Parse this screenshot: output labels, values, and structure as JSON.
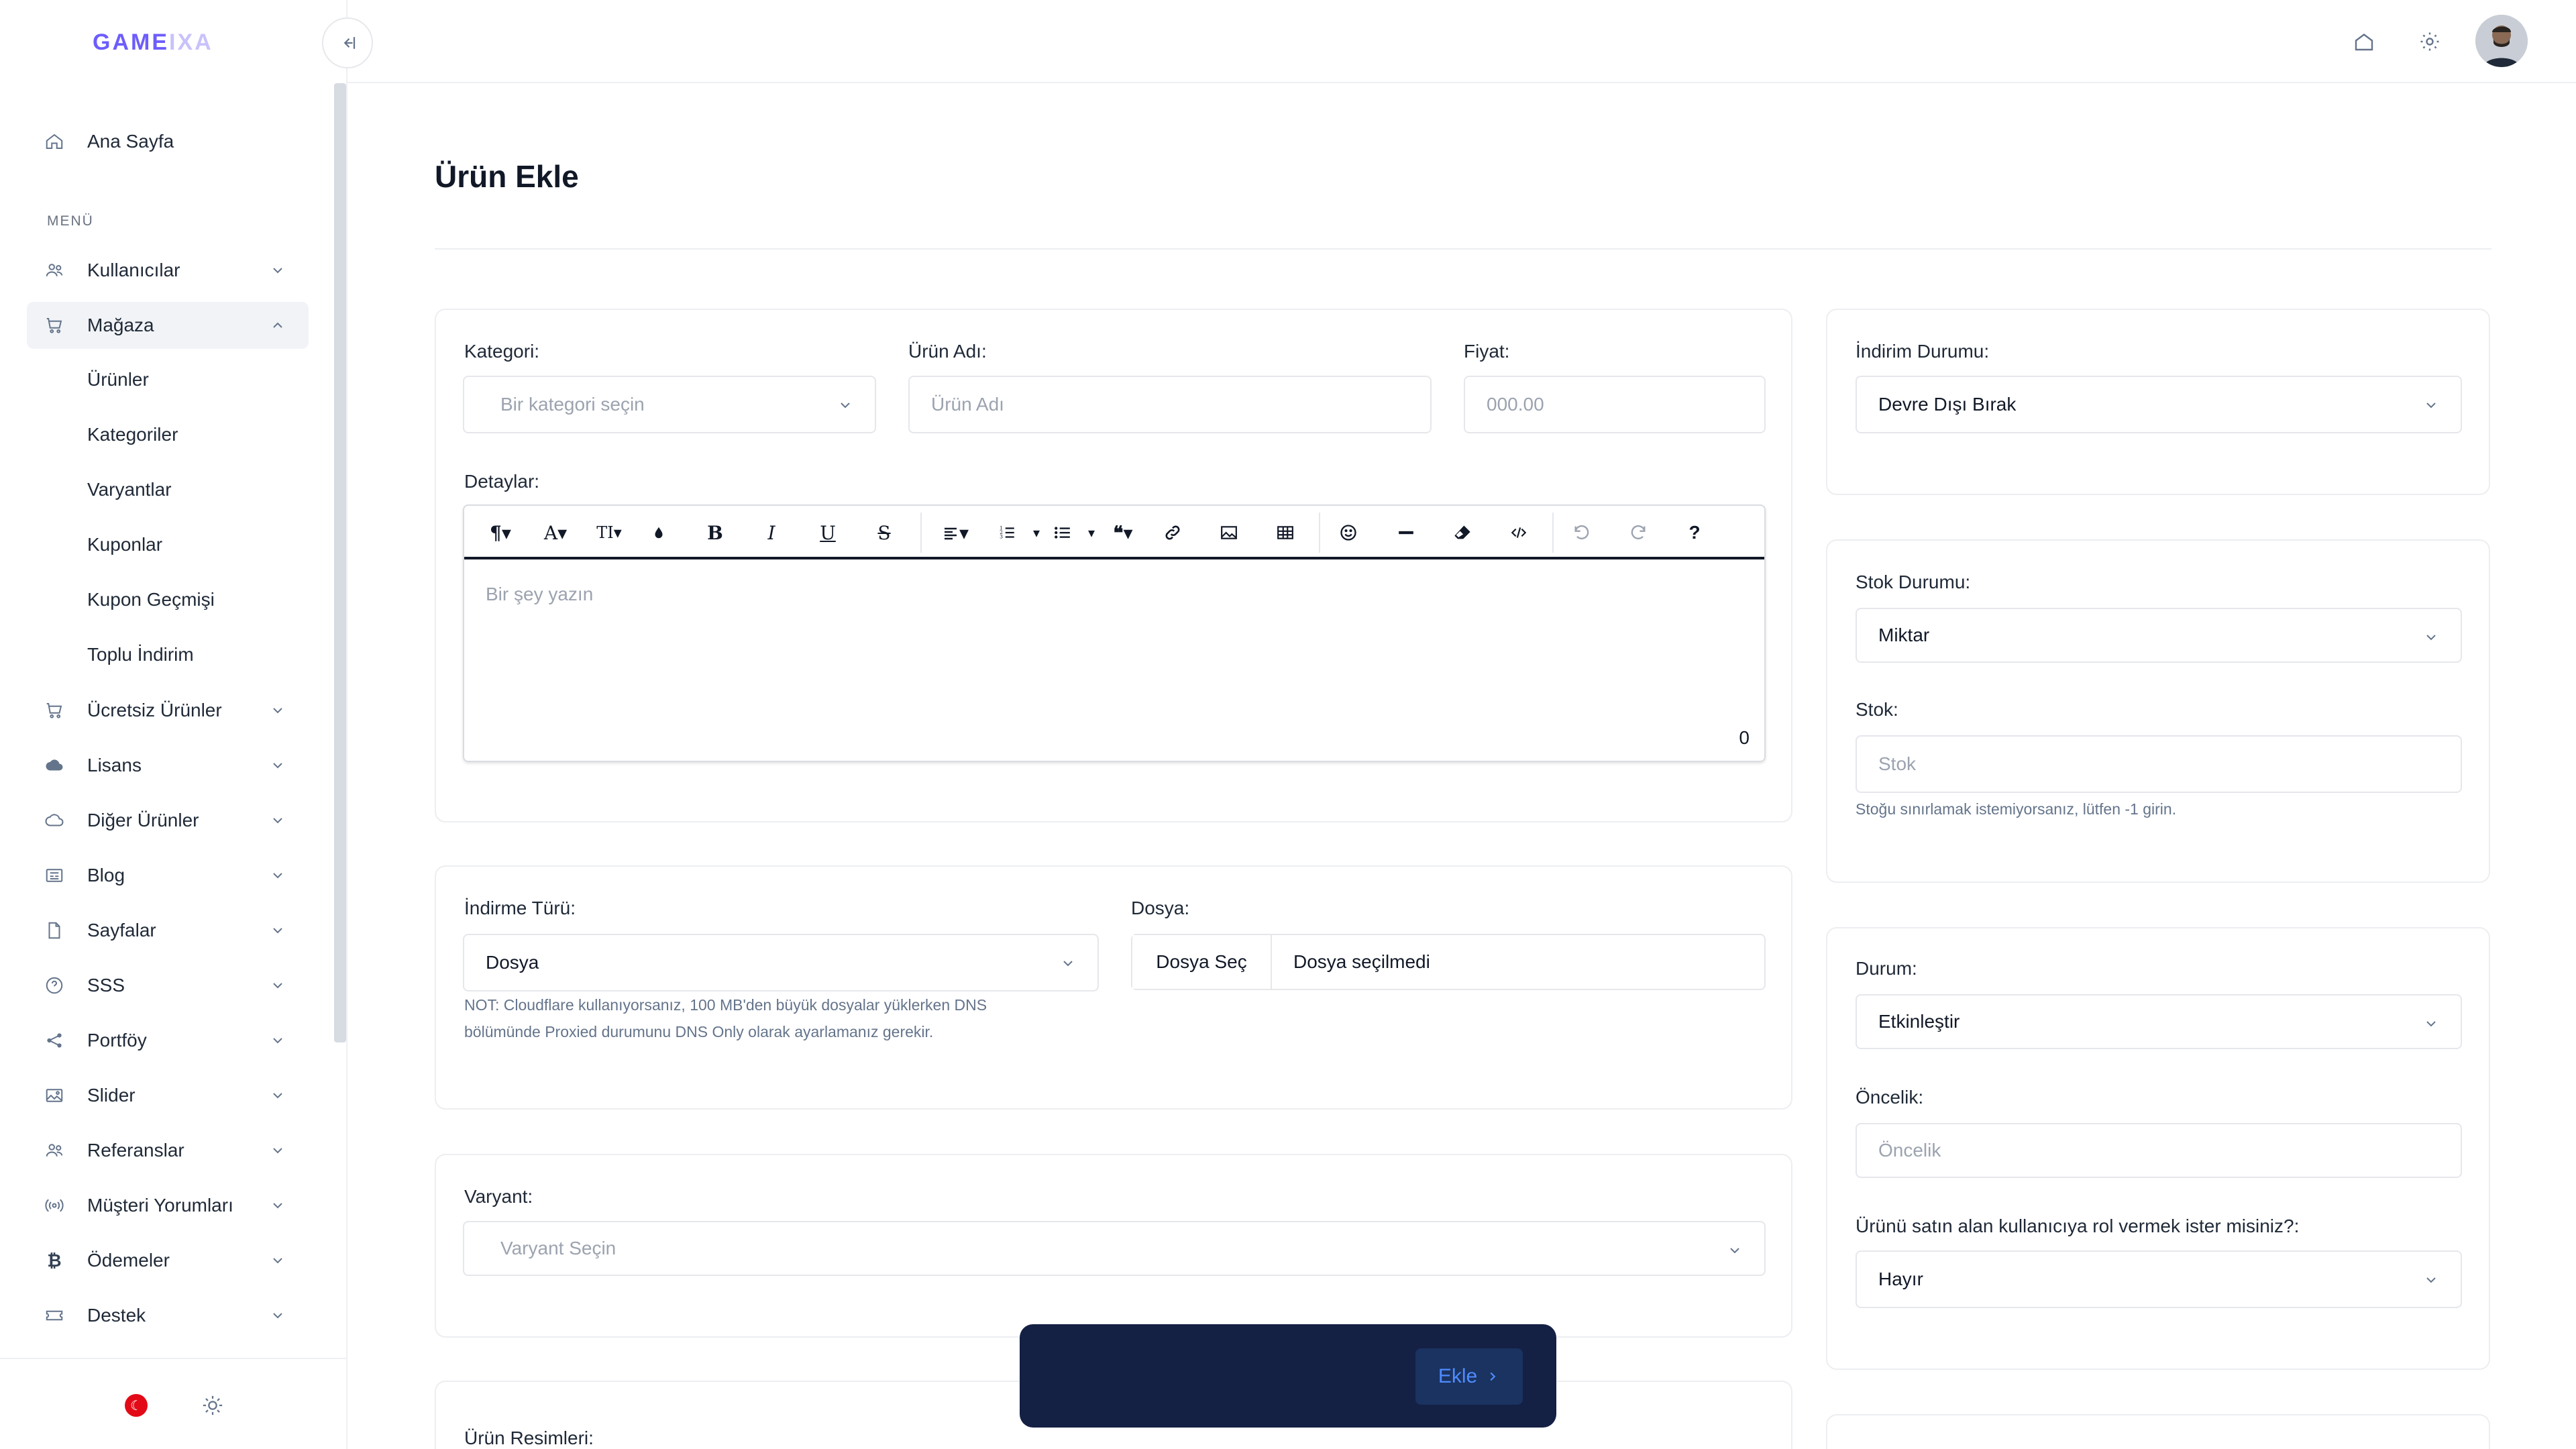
{
  "brand": {
    "logo_main": "GAME",
    "logo_fade": "IXA"
  },
  "sidebar": {
    "home_label": "Ana Sayfa",
    "menu_heading": "MENÜ",
    "items": [
      {
        "label": "Kullanıcılar",
        "icon": "users-icon"
      },
      {
        "label": "Mağaza",
        "icon": "cart-icon",
        "expanded": true
      },
      {
        "label": "Ücretsiz Ürünler",
        "icon": "cart-icon"
      },
      {
        "label": "Lisans",
        "icon": "cloud-icon"
      },
      {
        "label": "Diğer Ürünler",
        "icon": "cloud-outline-icon"
      },
      {
        "label": "Blog",
        "icon": "newspaper-icon"
      },
      {
        "label": "Sayfalar",
        "icon": "file-icon"
      },
      {
        "label": "SSS",
        "icon": "help-circle-icon"
      },
      {
        "label": "Portföy",
        "icon": "share-icon"
      },
      {
        "label": "Slider",
        "icon": "image-icon"
      },
      {
        "label": "Referanslar",
        "icon": "users-icon"
      },
      {
        "label": "Müşteri Yorumları",
        "icon": "broadcast-icon"
      },
      {
        "label": "Ödemeler",
        "icon": "bitcoin-icon"
      },
      {
        "label": "Destek",
        "icon": "ticket-icon"
      }
    ],
    "store_subitems": [
      "Ürünler",
      "Kategoriler",
      "Varyantlar",
      "Kuponlar",
      "Kupon Geçmişi",
      "Toplu İndirim"
    ]
  },
  "page": {
    "title": "Ürün Ekle"
  },
  "form": {
    "category": {
      "label": "Kategori:",
      "placeholder": "Bir kategori seçin"
    },
    "name": {
      "label": "Ürün Adı:",
      "placeholder": "Ürün Adı"
    },
    "price": {
      "label": "Fiyat:",
      "placeholder": "000.00"
    },
    "details": {
      "label": "Detaylar:",
      "placeholder": "Bir şey yazın",
      "char_count": "0"
    },
    "download_type": {
      "label": "İndirme Türü:",
      "value": "Dosya"
    },
    "file": {
      "label": "Dosya:",
      "button": "Dosya Seç",
      "status": "Dosya seçilmedi"
    },
    "file_note": [
      "NOT: Cloudflare kullanıyorsanız, 100 MB'den büyük dosyalar yüklerken DNS",
      "bölümünde Proxied durumunu DNS Only olarak ayarlamanız gerekir."
    ],
    "variant": {
      "label": "Varyant:",
      "placeholder": "Varyant Seçin"
    },
    "images": {
      "label": "Ürün Resimleri:"
    },
    "discount": {
      "label": "İndirim Durumu:",
      "value": "Devre Dışı Bırak"
    },
    "stock_status": {
      "label": "Stok Durumu:",
      "value": "Miktar"
    },
    "stock": {
      "label": "Stok:",
      "placeholder": "Stok",
      "hint": "Stoğu sınırlamak istemiyorsanız, lütfen -1 girin."
    },
    "status": {
      "label": "Durum:",
      "value": "Etkinleştir"
    },
    "priority": {
      "label": "Öncelik:",
      "placeholder": "Öncelik"
    },
    "role": {
      "label": "Ürünü satın alan kullanıcıya rol vermek ister misiniz?:",
      "value": "Hayır"
    }
  },
  "actions": {
    "submit": "Ekle"
  },
  "toolbar_glyphs": {
    "paragraph": "¶",
    "font": "A",
    "size": "TI",
    "bold": "B",
    "italic": "I",
    "underline": "U",
    "strike": "S",
    "help": "?"
  }
}
